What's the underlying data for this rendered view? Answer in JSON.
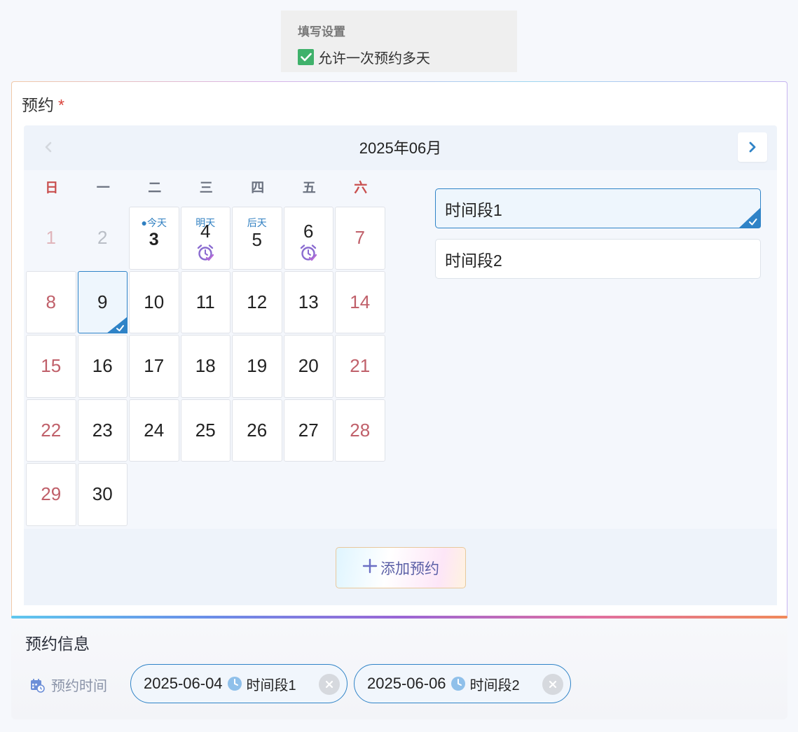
{
  "settings": {
    "title": "填写设置",
    "allow_multi_day": {
      "label": "允许一次预约多天",
      "checked": true
    }
  },
  "field": {
    "label": "预约",
    "required_mark": "*"
  },
  "calendar": {
    "month_title": "2025年06月",
    "weekdays": [
      "日",
      "一",
      "二",
      "三",
      "四",
      "五",
      "六"
    ],
    "days": [
      {
        "num": "1"
      },
      {
        "num": "2"
      },
      {
        "num": "3",
        "tag": "●今天"
      },
      {
        "num": "4",
        "tag": "明天"
      },
      {
        "num": "5",
        "tag": "后天"
      },
      {
        "num": "6"
      },
      {
        "num": "7"
      },
      {
        "num": "8"
      },
      {
        "num": "9"
      },
      {
        "num": "10"
      },
      {
        "num": "11"
      },
      {
        "num": "12"
      },
      {
        "num": "13"
      },
      {
        "num": "14"
      },
      {
        "num": "15"
      },
      {
        "num": "16"
      },
      {
        "num": "17"
      },
      {
        "num": "18"
      },
      {
        "num": "19"
      },
      {
        "num": "20"
      },
      {
        "num": "21"
      },
      {
        "num": "22"
      },
      {
        "num": "23"
      },
      {
        "num": "24"
      },
      {
        "num": "25"
      },
      {
        "num": "26"
      },
      {
        "num": "27"
      },
      {
        "num": "28"
      },
      {
        "num": "29"
      },
      {
        "num": "30"
      }
    ],
    "time_slots": [
      {
        "label": "时间段1",
        "selected": true
      },
      {
        "label": "时间段2",
        "selected": false
      }
    ],
    "add_button": "添加预约"
  },
  "info": {
    "heading": "预约信息",
    "time_label": "预约时间",
    "bookings": [
      {
        "date": "2025-06-04",
        "slot": "时间段1"
      },
      {
        "date": "2025-06-06",
        "slot": "时间段2"
      }
    ]
  },
  "colors": {
    "accent": "#2f83c7",
    "weekend": "#c9504f",
    "check_green": "#3fb16b"
  }
}
